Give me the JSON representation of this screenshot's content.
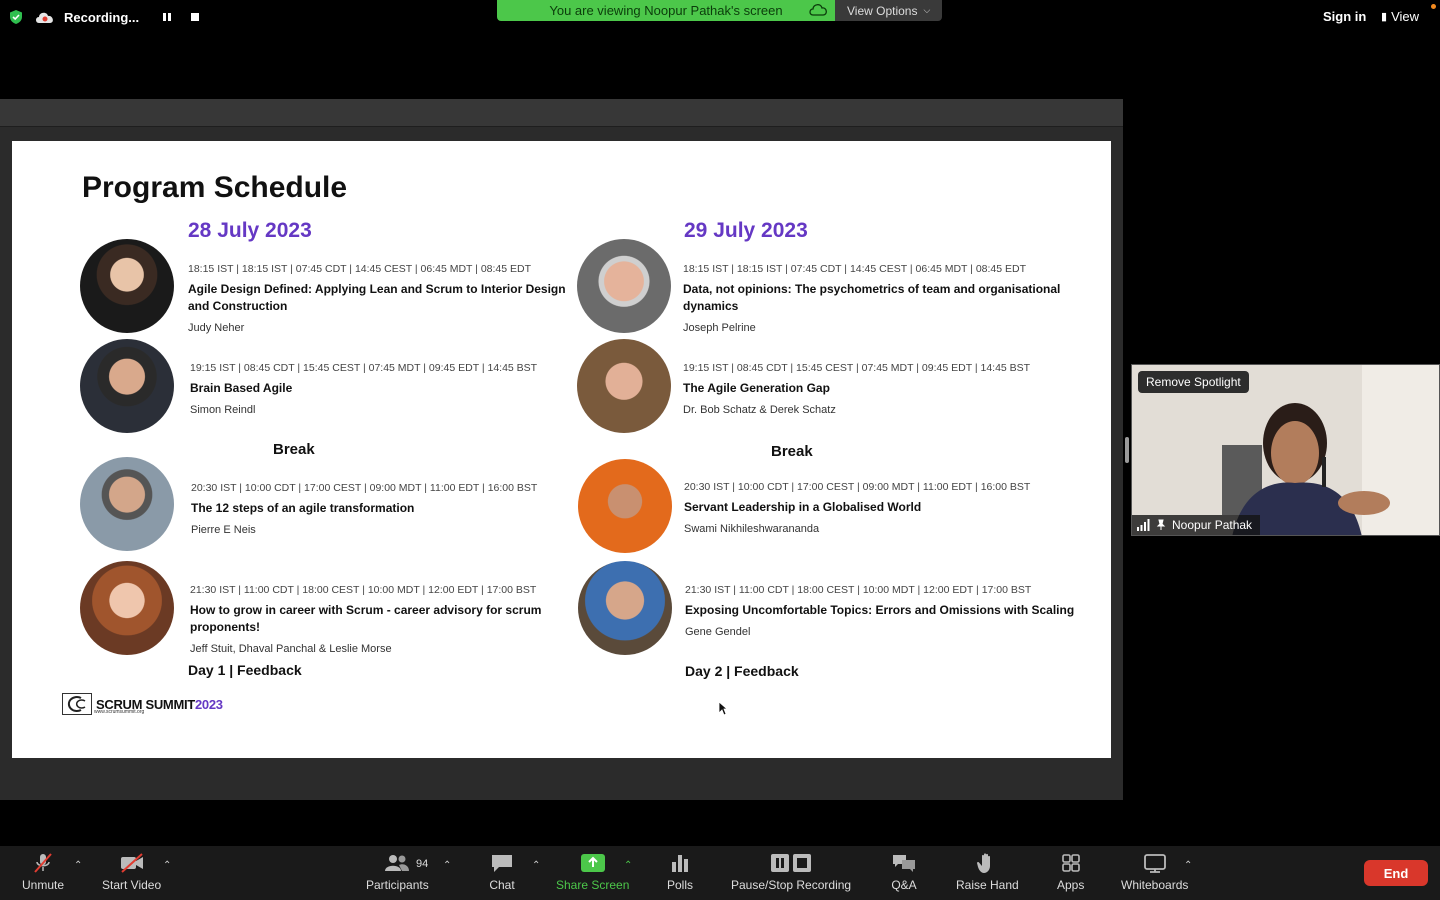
{
  "topbar": {
    "recording_label": "Recording...",
    "viewing_text": "You are viewing Noopur Pathak's screen",
    "view_options_label": "View Options",
    "sign_in_label": "Sign in",
    "view_label": "View"
  },
  "slide": {
    "title": "Program Schedule",
    "day1": {
      "date": "28 July 2023",
      "sessions": [
        {
          "time": "18:15 IST | 18:15 IST | 07:45 CDT | 14:45 CEST | 06:45 MDT | 08:45 EDT",
          "title": "Agile Design Defined: Applying Lean and Scrum to Interior Design and Construction",
          "speaker": "Judy Neher"
        },
        {
          "time": "19:15 IST | 08:45 CDT | 15:45 CEST | 07:45 MDT | 09:45 EDT | 14:45 BST",
          "title": "Brain Based Agile",
          "speaker": "Simon Reindl"
        },
        {
          "time": "20:30 IST | 10:00 CDT | 17:00 CEST | 09:00 MDT | 11:00 EDT | 16:00 BST",
          "title": "The 12 steps of an agile transformation",
          "speaker": "Pierre E Neis"
        },
        {
          "time": "21:30 IST | 11:00 CDT | 18:00 CEST | 10:00 MDT | 12:00 EDT | 17:00 BST",
          "title": "How to grow in career with Scrum - career advisory for scrum proponents!",
          "speaker": "Jeff Stuit, Dhaval Panchal & Leslie Morse"
        }
      ],
      "break_label": "Break",
      "feedback_label": "Day 1 | Feedback"
    },
    "day2": {
      "date": "29 July 2023",
      "sessions": [
        {
          "time": "18:15 IST | 18:15 IST | 07:45 CDT | 14:45 CEST | 06:45 MDT | 08:45 EDT",
          "title": "Data, not opinions: The psychometrics of team and organisational dynamics",
          "speaker": "Joseph Pelrine"
        },
        {
          "time": "19:15 IST | 08:45 CDT | 15:45 CEST | 07:45 MDT | 09:45 EDT | 14:45 BST",
          "title": "The Agile Generation Gap",
          "speaker": "Dr. Bob Schatz & Derek Schatz"
        },
        {
          "time": "20:30 IST | 10:00 CDT | 17:00 CEST | 09:00 MDT | 11:00 EDT | 16:00 BST",
          "title": "Servant Leadership in a Globalised World",
          "speaker": "Swami Nikhileshwarananda"
        },
        {
          "time": "21:30 IST | 11:00 CDT | 18:00 CEST | 10:00 MDT | 12:00 EDT | 17:00 BST",
          "title": "Exposing Uncomfortable Topics: Errors and Omissions with Scaling",
          "speaker": "Gene Gendel"
        }
      ],
      "break_label": "Break",
      "feedback_label": "Day 2 | Feedback"
    },
    "logo": {
      "name": "SCRUM SUMMIT",
      "year": "2023",
      "url": "www.scrumsummit.org"
    }
  },
  "video": {
    "remove_spotlight_label": "Remove Spotlight",
    "participant_name": "Noopur Pathak"
  },
  "toolbar": {
    "unmute": "Unmute",
    "start_video": "Start Video",
    "participants": "Participants",
    "participants_count": "94",
    "chat": "Chat",
    "share_screen": "Share Screen",
    "polls": "Polls",
    "pause_stop_recording": "Pause/Stop Recording",
    "qa": "Q&A",
    "raise_hand": "Raise Hand",
    "apps": "Apps",
    "whiteboards": "Whiteboards",
    "end": "End"
  },
  "colors": {
    "accent_green": "#4cc74a",
    "date_purple": "#6538c4",
    "end_red": "#d9372b"
  }
}
